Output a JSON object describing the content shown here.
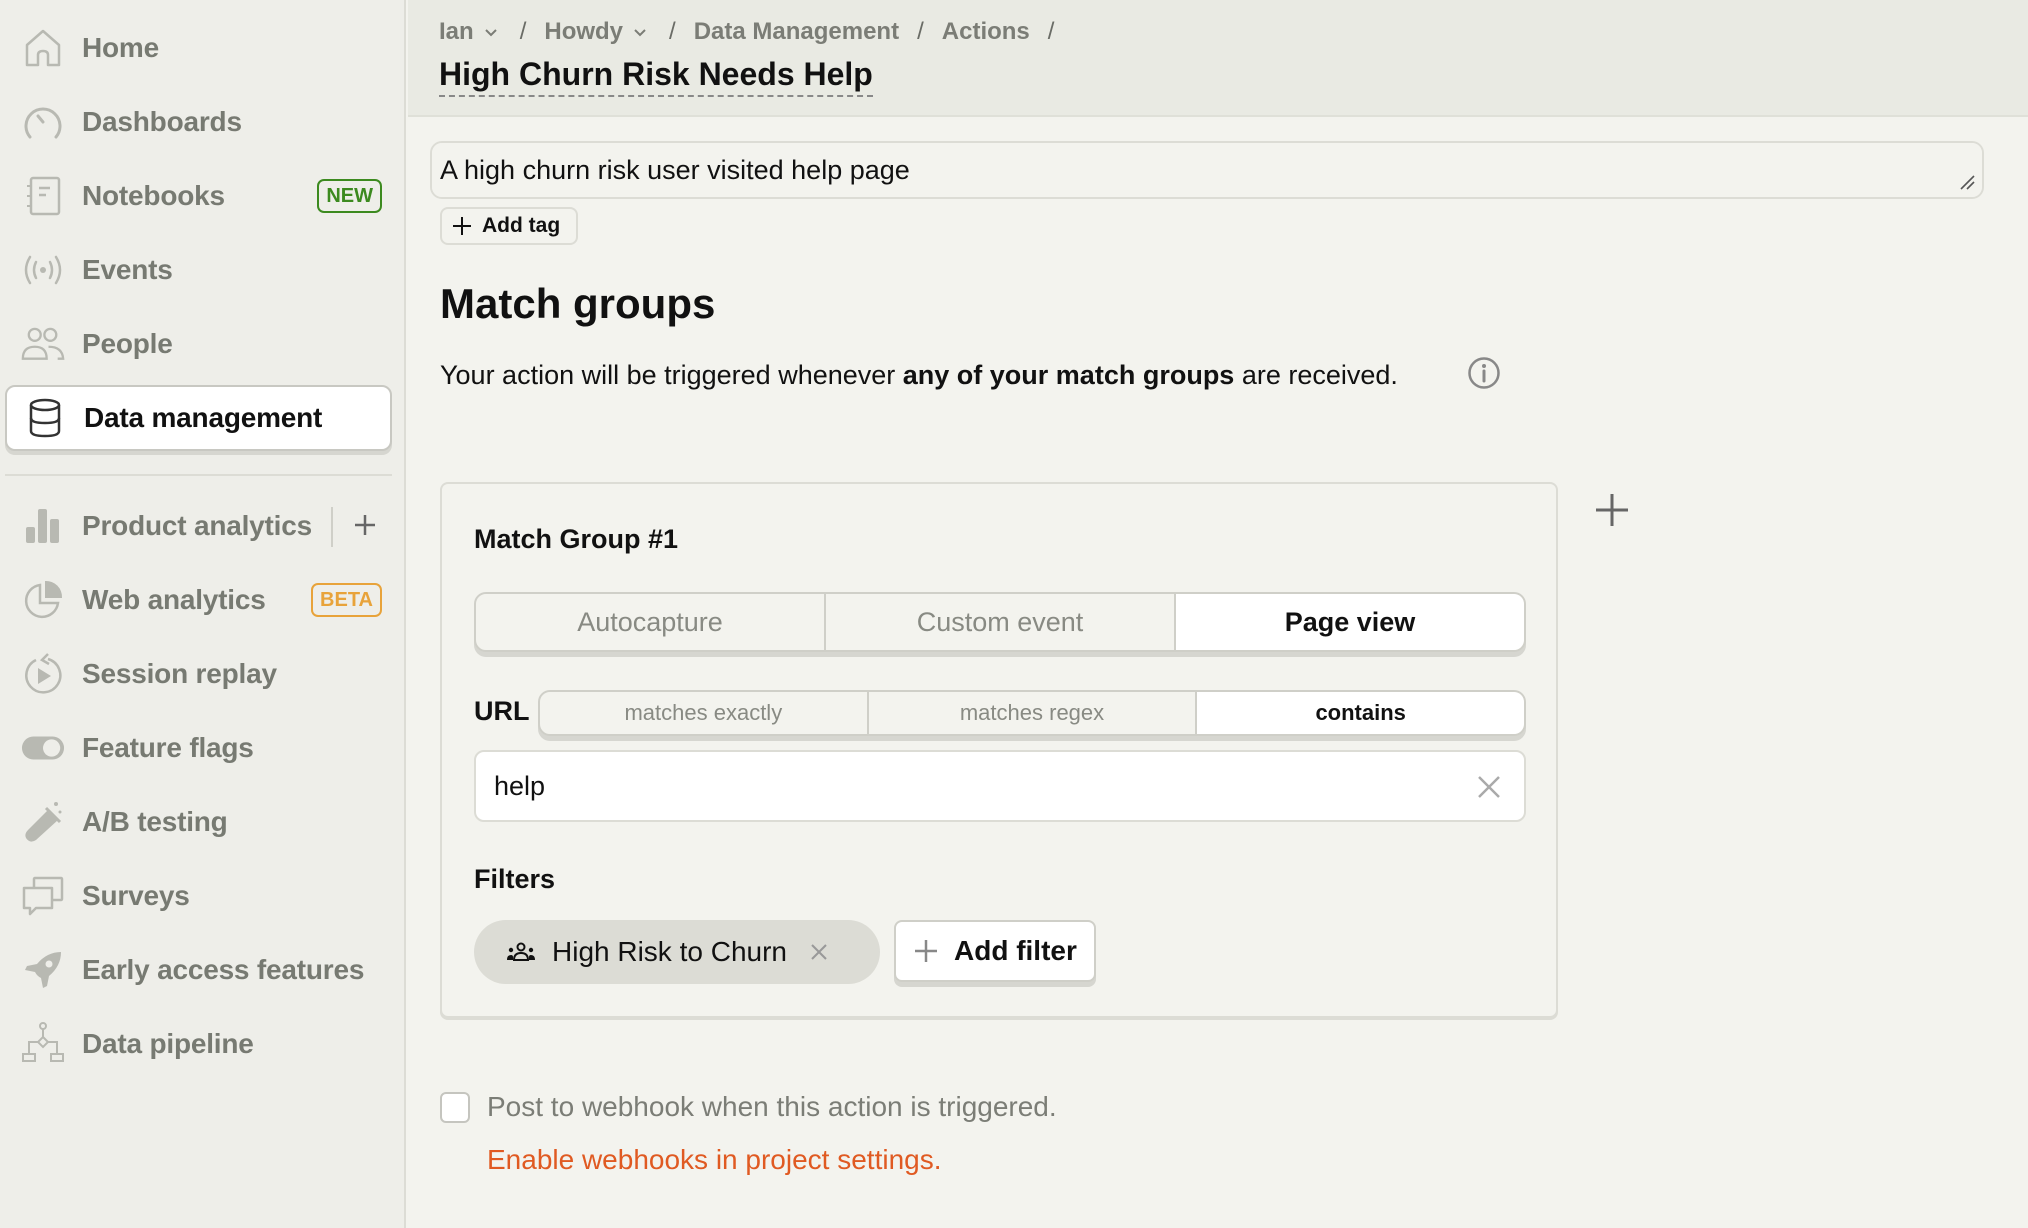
{
  "sidebar": {
    "items": [
      {
        "label": "Home",
        "icon": "home-icon"
      },
      {
        "label": "Dashboards",
        "icon": "dashboard-gauge-icon"
      },
      {
        "label": "Notebooks",
        "icon": "notebook-icon",
        "badge": "NEW"
      },
      {
        "label": "Events",
        "icon": "broadcast-icon"
      },
      {
        "label": "People",
        "icon": "people-icon"
      },
      {
        "label": "Data management",
        "icon": "database-icon",
        "active": true
      }
    ],
    "products": [
      {
        "label": "Product analytics",
        "icon": "bar-chart-icon"
      },
      {
        "label": "Web analytics",
        "icon": "pie-chart-icon",
        "badge": "BETA"
      },
      {
        "label": "Session replay",
        "icon": "replay-icon"
      },
      {
        "label": "Feature flags",
        "icon": "toggle-icon"
      },
      {
        "label": "A/B testing",
        "icon": "flask-icon"
      },
      {
        "label": "Surveys",
        "icon": "chat-bubbles-icon"
      },
      {
        "label": "Early access features",
        "icon": "rocket-icon"
      },
      {
        "label": "Data pipeline",
        "icon": "pipeline-icon"
      }
    ],
    "badge_colors": {
      "new": "#3c8a1f",
      "beta": "#e8a33a"
    }
  },
  "header": {
    "breadcrumbs": [
      {
        "label": "Ian",
        "dropdown": true
      },
      {
        "label": "Howdy",
        "dropdown": true
      },
      {
        "label": "Data Management",
        "dropdown": false
      },
      {
        "label": "Actions",
        "dropdown": false
      }
    ],
    "separator": "/",
    "title": "High Churn Risk Needs Help"
  },
  "action": {
    "description": "A high churn risk user visited help page",
    "add_tag_label": "Add tag"
  },
  "match_groups": {
    "title": "Match groups",
    "description_prefix": "Your action will be triggered whenever ",
    "description_bold": "any of your match groups",
    "description_suffix": " are received.",
    "groups": [
      {
        "title": "Match Group #1",
        "event_types": [
          "Autocapture",
          "Custom event",
          "Page view"
        ],
        "selected_event_type": "Page view",
        "url_label": "URL",
        "url_match_options": [
          "matches exactly",
          "matches regex",
          "contains"
        ],
        "selected_url_match": "contains",
        "url_value": "help",
        "filters_label": "Filters",
        "filters": [
          {
            "label": "High Risk to Churn",
            "icon": "cohort-icon"
          }
        ],
        "add_filter_label": "Add filter"
      }
    ]
  },
  "webhook": {
    "checkbox_label": "Post to webhook when this action is triggered.",
    "checked": false,
    "enable_link": "Enable webhooks in project settings.",
    "link_color": "#e05a22"
  }
}
